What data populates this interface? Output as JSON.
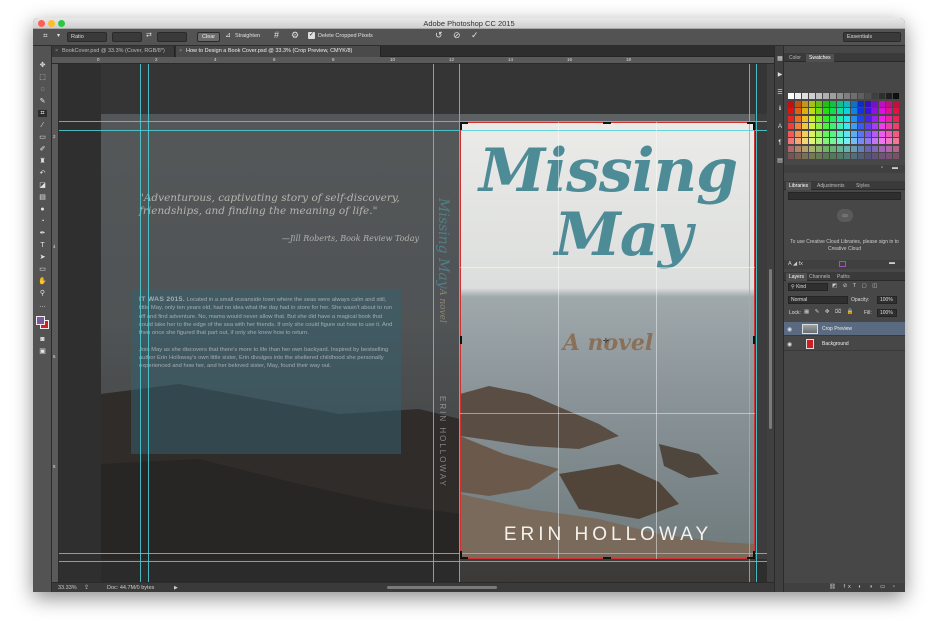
{
  "window": {
    "title": "Adobe Photoshop CC 2015"
  },
  "options_bar": {
    "ratio_select": "Ratio",
    "clear_label": "Clear",
    "straighten_label": "Straighten",
    "delete_cropped_label": "Delete Cropped Pixels",
    "workspace_select": "Essentials"
  },
  "tabs": [
    {
      "label": "BookCover.psd @ 33.3% (Cover, RGB/8*)",
      "close": "×"
    },
    {
      "label": "How to Design a Book Cover.psd @ 33.3% (Crop Preview, CMYK/8)",
      "close": "×"
    }
  ],
  "ruler": {
    "top": [
      "0",
      "2",
      "4",
      "6",
      "8",
      "10",
      "12",
      "14",
      "16",
      "18"
    ],
    "left": [
      "2",
      "4",
      "6",
      "8"
    ]
  },
  "status": {
    "zoom": "33.33%",
    "doc": "Doc: 44.7M/0 bytes"
  },
  "panels": {
    "color_tabs": [
      "Color",
      "Swatches"
    ],
    "library_tabs": [
      "Libraries",
      "Adjustments",
      "Styles"
    ],
    "cc_message": "To use Creative Cloud Libraries, please sign in to Creative Cloud",
    "layers_tabs": [
      "Layers",
      "Channels",
      "Paths"
    ],
    "kind_filter": "Kind",
    "blend_mode": "Normal",
    "opacity_label": "Opacity:",
    "opacity_value": "100%",
    "lock_label": "Lock:",
    "fill_label": "Fill:",
    "fill_value": "100%",
    "layers": [
      {
        "name": "Crop Preview",
        "selected": true
      },
      {
        "name": "Background",
        "selected": false
      }
    ]
  },
  "cover": {
    "quote": "\"Adventurous, captivating story of self-discovery, friendships, and finding the meaning of life.\"",
    "quote_attribution": "—Jill Roberts, Book Review Today",
    "blurb_lead": "IT WAS 2015.",
    "blurb_p1": "Located in a small oceanside town where the seas were always calm and still, little May, only ten years old, had no idea what the day had in store for her. She wasn't about to run off and find adventure. No, mama would never allow that. But she did have a magical book that could take her to the edge of the sea with her friends. If only she could figure out how to use it. And then once she figured that part out, if only she knew how to return.",
    "blurb_p2": "Join May as she discovers that there's more to life than her own backyard. Inspired by bestselling author Erin Holloway's own little sister, Erin divulges into the sheltered childhood she personally experienced and how her, and her beloved sister, May, found their way out.",
    "spine_title": "Missing May",
    "spine_subtitle": "A novel",
    "spine_author": "ERIN HOLLOWAY",
    "front_title_line1": "Missing",
    "front_title_line2": "May",
    "front_subtitle": "A novel",
    "front_author": "ERIN HOLLOWAY"
  },
  "colors": {
    "accent_teal": "#4d8c97",
    "subtitle_brown": "#8a7058",
    "guide_cyan": "#4ed0d8",
    "crop_red": "#cf3030",
    "foreground_swatch": "#7b5a9c",
    "background_swatch": "#d42020"
  }
}
